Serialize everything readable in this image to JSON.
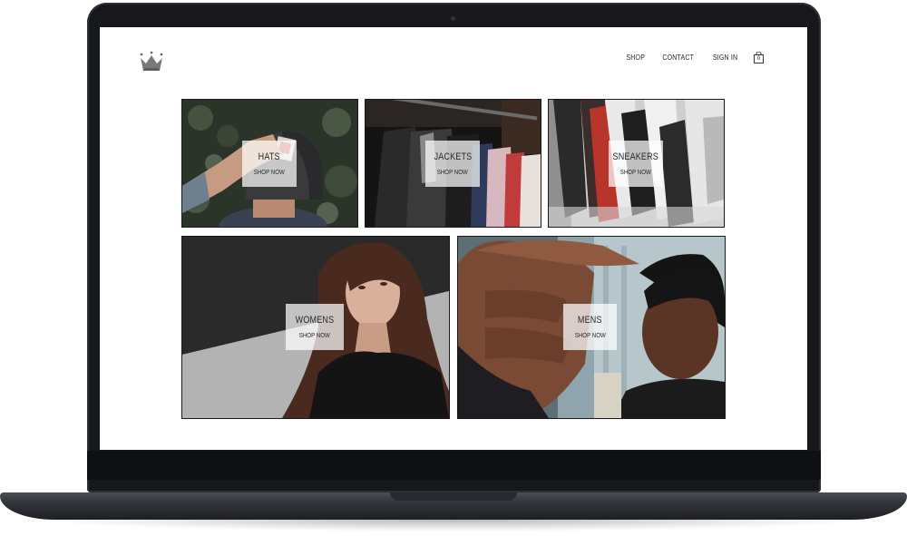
{
  "nav": {
    "links": [
      "SHOP",
      "CONTACT",
      "SIGN IN"
    ],
    "cart_count": "0"
  },
  "categories": [
    {
      "title": "HATS",
      "cta": "SHOP NOW"
    },
    {
      "title": "JACKETS",
      "cta": "SHOP NOW"
    },
    {
      "title": "SNEAKERS",
      "cta": "SHOP NOW"
    },
    {
      "title": "WOMENS",
      "cta": "SHOP NOW"
    },
    {
      "title": "MENS",
      "cta": "SHOP NOW"
    }
  ],
  "icons": {
    "logo": "crown-icon",
    "cart": "shopping-bag-icon"
  },
  "colors": {
    "laptop_frame": "#16181b",
    "screen_background": "#ffffff",
    "text": "#222222",
    "label_overlay": "#ffffffb8"
  }
}
